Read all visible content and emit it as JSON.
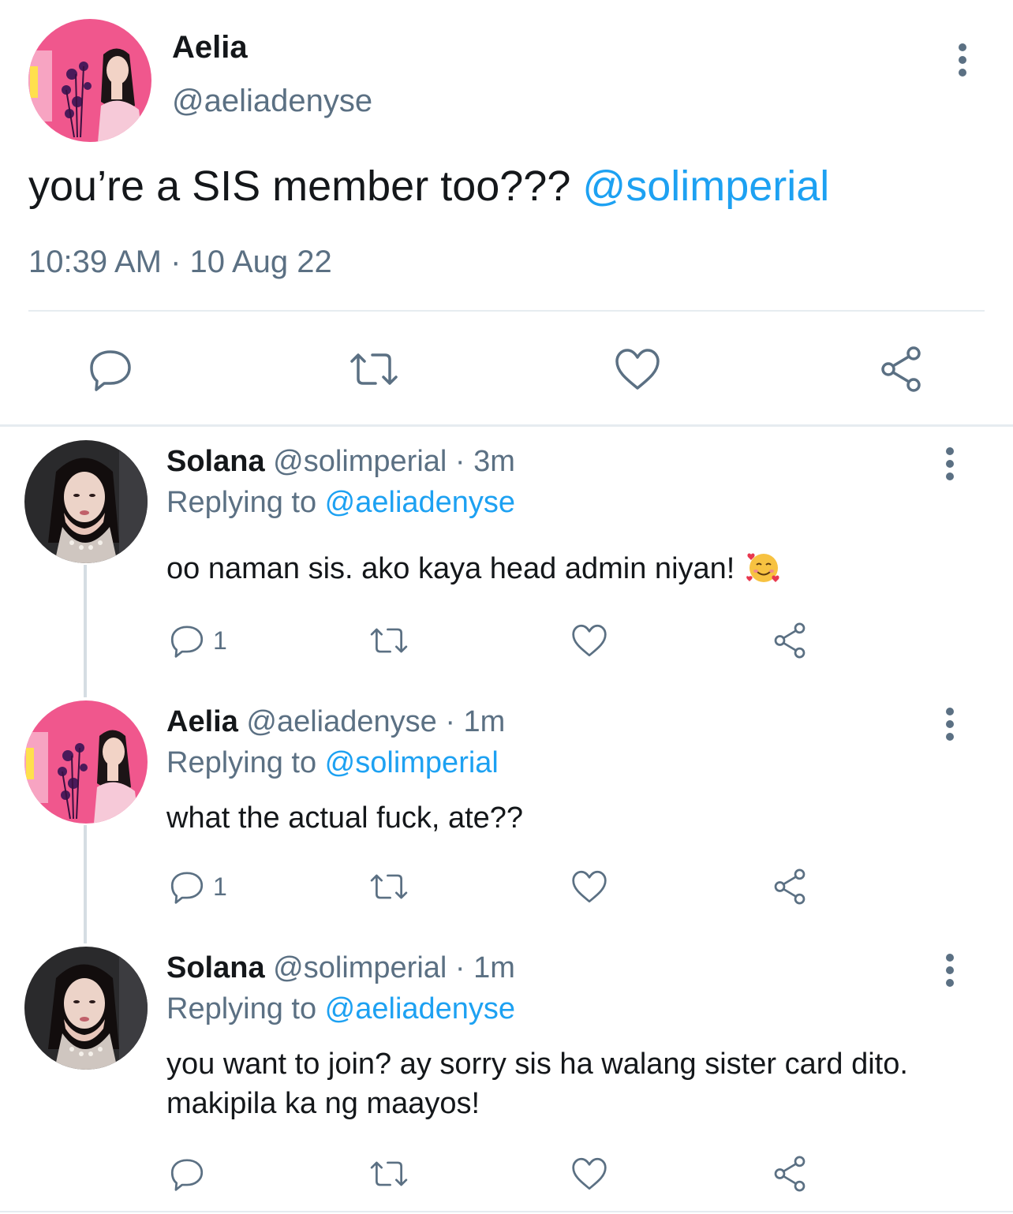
{
  "main_tweet": {
    "name": "Aelia",
    "handle": "@aeliadenyse",
    "text": "you’re a SIS member too??? ",
    "mention": "@solimperial",
    "timestamp": "10:39 AM · 10 Aug 22",
    "actions": [
      "reply-icon",
      "retweet-icon",
      "like-icon",
      "share-icon"
    ]
  },
  "replies": [
    {
      "name": "Solana",
      "meta": " @solimperial · 3m",
      "replying_label": "Replying to ",
      "replying_to": "@aeliadenyse",
      "text": "oo naman sis. ako kaya head admin niyan! ",
      "emoji": "smiling-face-with-hearts",
      "reply_count": "1"
    },
    {
      "name": "Aelia",
      "meta": " @aeliadenyse · 1m",
      "replying_label": "Replying to ",
      "replying_to": "@solimperial",
      "text": "what the actual fuck, ate??",
      "reply_count": "1"
    },
    {
      "name": "Solana",
      "meta": " @solimperial · 1m",
      "replying_label": "Replying to ",
      "replying_to": "@aeliadenyse",
      "text": "you want to join? ay sorry sis ha walang sister card dito. makipila ka ng maayos!",
      "reply_count": ""
    }
  ],
  "colors": {
    "text": "#14171a",
    "secondary": "#5b7083",
    "link": "#1da1f2",
    "divider": "#e6ecf0",
    "thread_line": "#d5dde3",
    "avatar_pink": "#f0578d"
  }
}
